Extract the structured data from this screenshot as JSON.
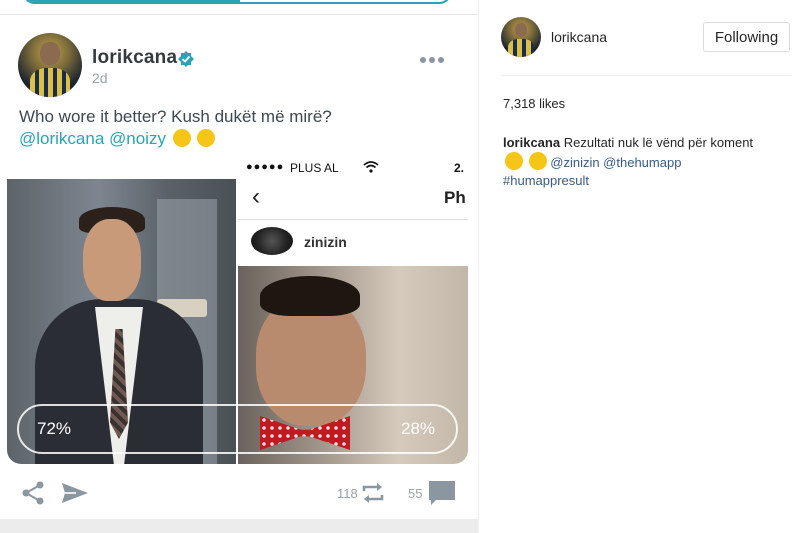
{
  "post": {
    "username": "lorikcana",
    "time": "2d",
    "caption_text": "Who wore it better? Kush dukët më mirë?",
    "caption_mentions": "@lorikcana @noizy",
    "poll": {
      "left_percent": "72%",
      "right_percent": "28%"
    },
    "embedded_screenshot": {
      "carrier": "PLUS AL",
      "signal_dots": "●●●●●",
      "clock": "2.",
      "nav_title": "Ph",
      "username": "zinizin"
    },
    "actions": {
      "reposts": "118",
      "comments": "55"
    }
  },
  "sidebar": {
    "username": "lorikcana",
    "follow_label": "Following",
    "likes": "7,318 likes",
    "caption_user": "lorikcana",
    "caption_text": "Rezultati nuk lë vënd për koment",
    "mentions": "@zinizin @thehumapp",
    "hashtag": "#humappresult"
  },
  "colors": {
    "accent": "#2aa3b5",
    "link": "#3b5b86",
    "verified": "#2aa3b5"
  }
}
